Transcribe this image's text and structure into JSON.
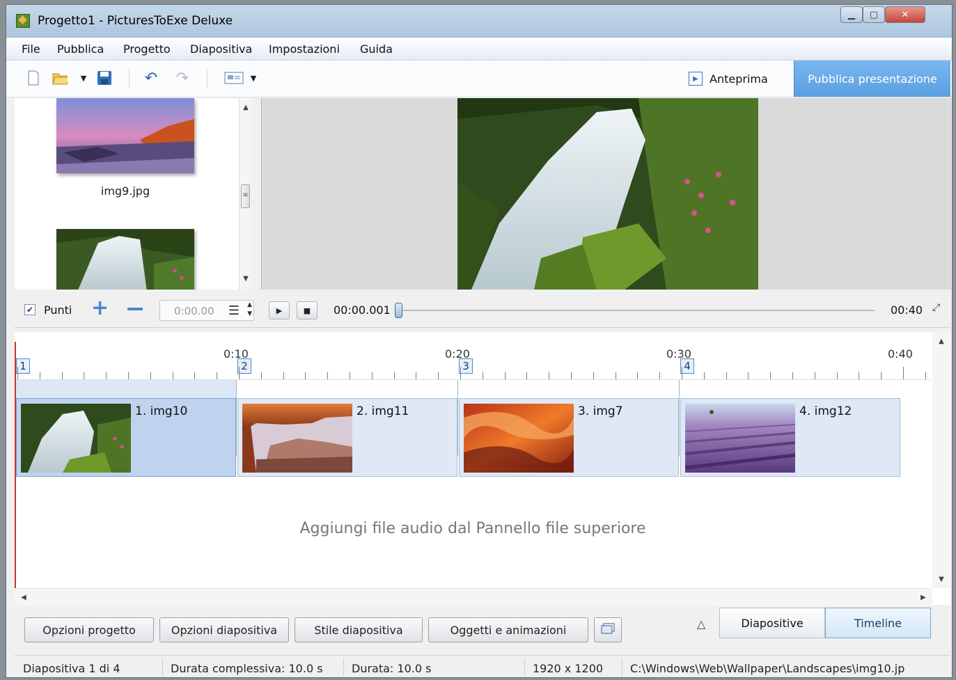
{
  "window": {
    "title": "Progetto1 - PicturesToExe Deluxe"
  },
  "menu": [
    "File",
    "Pubblica",
    "Progetto",
    "Diapositiva",
    "Impostazioni",
    "Guida"
  ],
  "toolbar": {
    "preview_label": "Anteprima",
    "publish_label": "Pubblica presentazione"
  },
  "file_panel": {
    "items": [
      {
        "name": "img9.jpg"
      },
      {
        "name": ""
      }
    ]
  },
  "playback": {
    "punti_label": "Punti",
    "punti_checked": true,
    "time_field": "0:00.00",
    "current_time": "00:00.001",
    "end_time": "00:40",
    "progress": 0
  },
  "timeline": {
    "ruler_labels": [
      "0:10",
      "0:20",
      "0:30",
      "0:40"
    ],
    "markers": [
      "1",
      "2",
      "3",
      "4"
    ],
    "clips": [
      {
        "label": "1. img10"
      },
      {
        "label": "2. img11"
      },
      {
        "label": "3. img7"
      },
      {
        "label": "4. img12"
      }
    ],
    "audio_hint": "Aggiungi file audio dal Pannello file superiore"
  },
  "buttons": {
    "project_options": "Opzioni progetto",
    "slide_options": "Opzioni diapositiva",
    "slide_style": "Stile diapositiva",
    "objects_animations": "Oggetti e animazioni"
  },
  "tabs": {
    "slides": "Diapositive",
    "timeline": "Timeline",
    "active": "Timeline"
  },
  "status": {
    "slide": "Diapositiva 1 di 4",
    "total_duration": "Durata complessiva: 10.0 s",
    "duration": "Durata: 10.0 s",
    "resolution": "1920 x 1200",
    "path": "C:\\Windows\\Web\\Wallpaper\\Landscapes\\img10.jp"
  },
  "colors": {
    "accent": "#5a9fe2",
    "selection": "#bfd3ef",
    "playhead": "#c0392b"
  }
}
